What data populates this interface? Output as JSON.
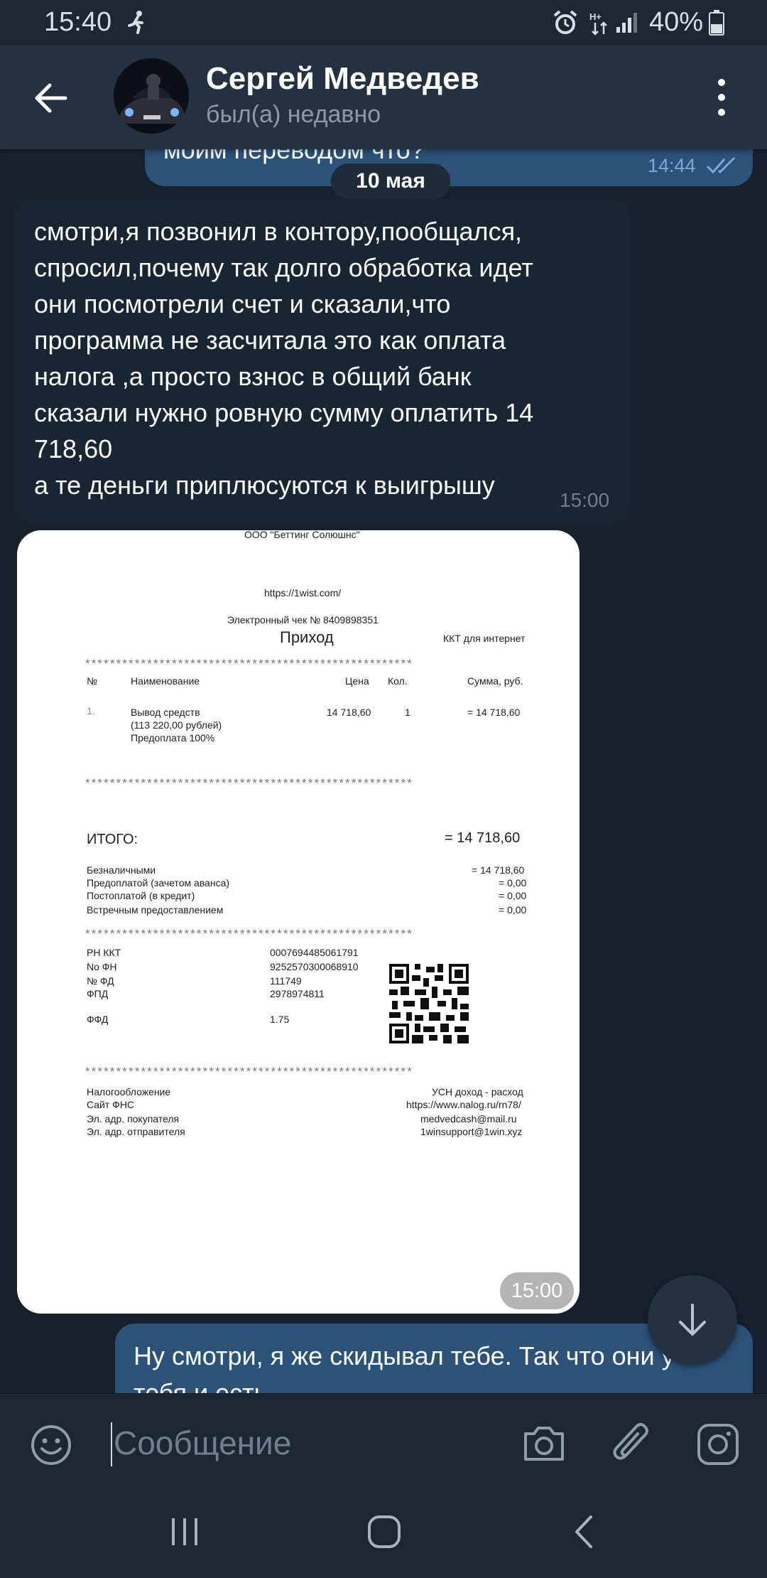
{
  "status_bar": {
    "time": "15:40",
    "battery": "40%",
    "icons": [
      "running-icon",
      "alarm-icon",
      "mobile-data-icon",
      "signal-icon",
      "battery-icon"
    ]
  },
  "header": {
    "name": "Сергей Медведев",
    "status": "был(а) недавно"
  },
  "messages": {
    "top_outgoing": {
      "text": "моим переводом что?",
      "time": "14:44"
    },
    "date_separator": "10 мая",
    "incoming": {
      "text": "смотри,я позвонил в контору,пообщался,\nспросил,почему так долго обработка идет\nони посмотрели счет и сказали,что\nпрограмма не засчитала это как оплата\nналога ,а просто взнос в общий банк\nсказали нужно ровную сумму оплатить 14\n718,60\nа те деньги приплюсуются к выигрышу",
      "time": "15:00"
    },
    "photo_time": "15:00",
    "bottom_outgoing": {
      "text": "Ну смотри, я же скидывал тебе. Так что они у\nтебя и есть"
    }
  },
  "receipt": {
    "company": "ООО \"Беттинг Солюшнс\"",
    "site": "https://1wist.com/",
    "check_no": "Электронный чек № 8409898351",
    "type": "Приход",
    "kkt": "ККТ для интернет",
    "columns": {
      "num": "№",
      "name": "Наименование",
      "price": "Цена",
      "qty": "Кол.",
      "sum": "Сумма, руб."
    },
    "item": {
      "num": "1.",
      "name1": "Вывод средств",
      "name2": "(113 220,00 рублей)",
      "name3": "Предоплата 100%",
      "price": "14 718,60",
      "qty": "1",
      "sum": "=  14 718,60"
    },
    "total_label": "ИТОГО:",
    "total_value": "=  14 718,60",
    "payments": [
      {
        "label": "Безналичными",
        "value": "=  14 718,60"
      },
      {
        "label": "Предоплатой (зачетом аванса)",
        "value": "= 0,00"
      },
      {
        "label": "Постоплатой (в кредит)",
        "value": "= 0,00"
      },
      {
        "label": "Встречным предоставлением",
        "value": "= 0,00"
      }
    ],
    "fiscal": [
      {
        "label": "РН ККТ",
        "value": "0007694485061791"
      },
      {
        "label": "No ФН",
        "value": "9252570300068910"
      },
      {
        "label": "№ ФД",
        "value": "111749"
      },
      {
        "label": "ФПД",
        "value": "2978974811"
      },
      {
        "label": "ФФД",
        "value": "1.75"
      }
    ],
    "footer": [
      {
        "label": "Налогообложение",
        "value": "УСН доход - расход"
      },
      {
        "label": "Сайт ФНС",
        "value": "https://www.nalog.ru/rn78/"
      },
      {
        "label": "Эл. адр. покупателя",
        "value": "medvedcash@mail.ru"
      },
      {
        "label": "Эл. адр. отправителя",
        "value": "1winsupport@1win.xyz"
      }
    ],
    "stars": "*****************************************************"
  },
  "input": {
    "placeholder": "Сообщение"
  },
  "colors": {
    "background": "#17212b",
    "header": "#243140",
    "outgoing_bubble": "#2b5278",
    "incoming_bubble": "#182533"
  }
}
